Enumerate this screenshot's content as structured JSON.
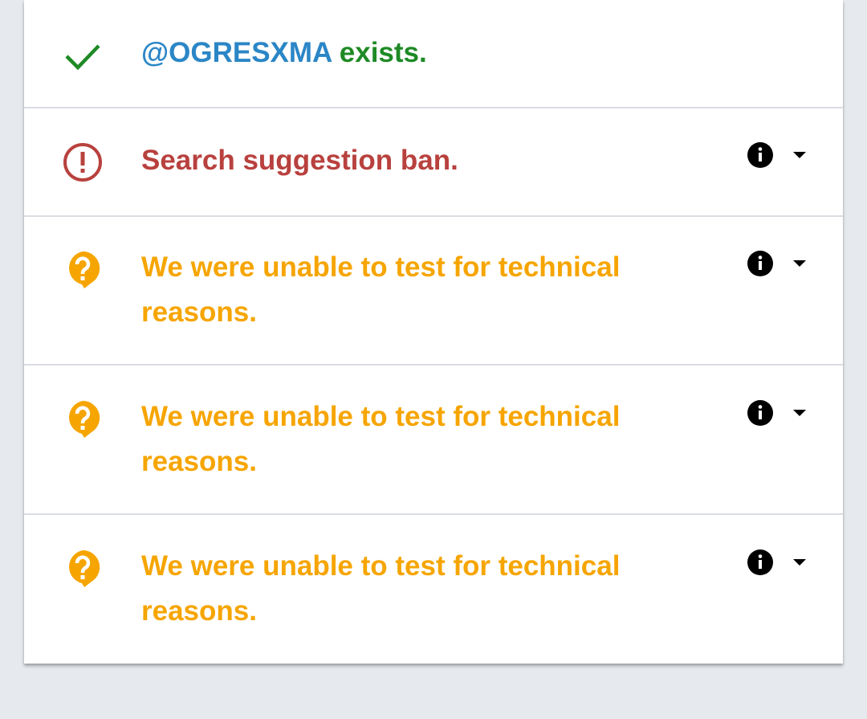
{
  "colors": {
    "background": "#e6eaee",
    "card": "#ffffff",
    "handle": "#2b86c6",
    "ok": "#1e8a25",
    "ban": "#b8413e",
    "unknown": "#f6a500",
    "info_icon": "#000000"
  },
  "rows": [
    {
      "status": "ok",
      "icon": "checkmark-icon",
      "handle": "@OGRESXMA",
      "text": "exists."
    },
    {
      "status": "ban",
      "icon": "exclamation-circle-icon",
      "text": "Search suggestion ban.",
      "controls": [
        "info-icon",
        "chevron-down-icon"
      ]
    },
    {
      "status": "unknown",
      "icon": "question-bubble-icon",
      "text": "We were unable to test for technical reasons.",
      "controls": [
        "info-icon",
        "chevron-down-icon"
      ]
    },
    {
      "status": "unknown",
      "icon": "question-bubble-icon",
      "text": "We were unable to test for technical reasons.",
      "controls": [
        "info-icon",
        "chevron-down-icon"
      ]
    },
    {
      "status": "unknown",
      "icon": "question-bubble-icon",
      "text": "We were unable to test for technical reasons.",
      "controls": [
        "info-icon",
        "chevron-down-icon"
      ]
    }
  ]
}
